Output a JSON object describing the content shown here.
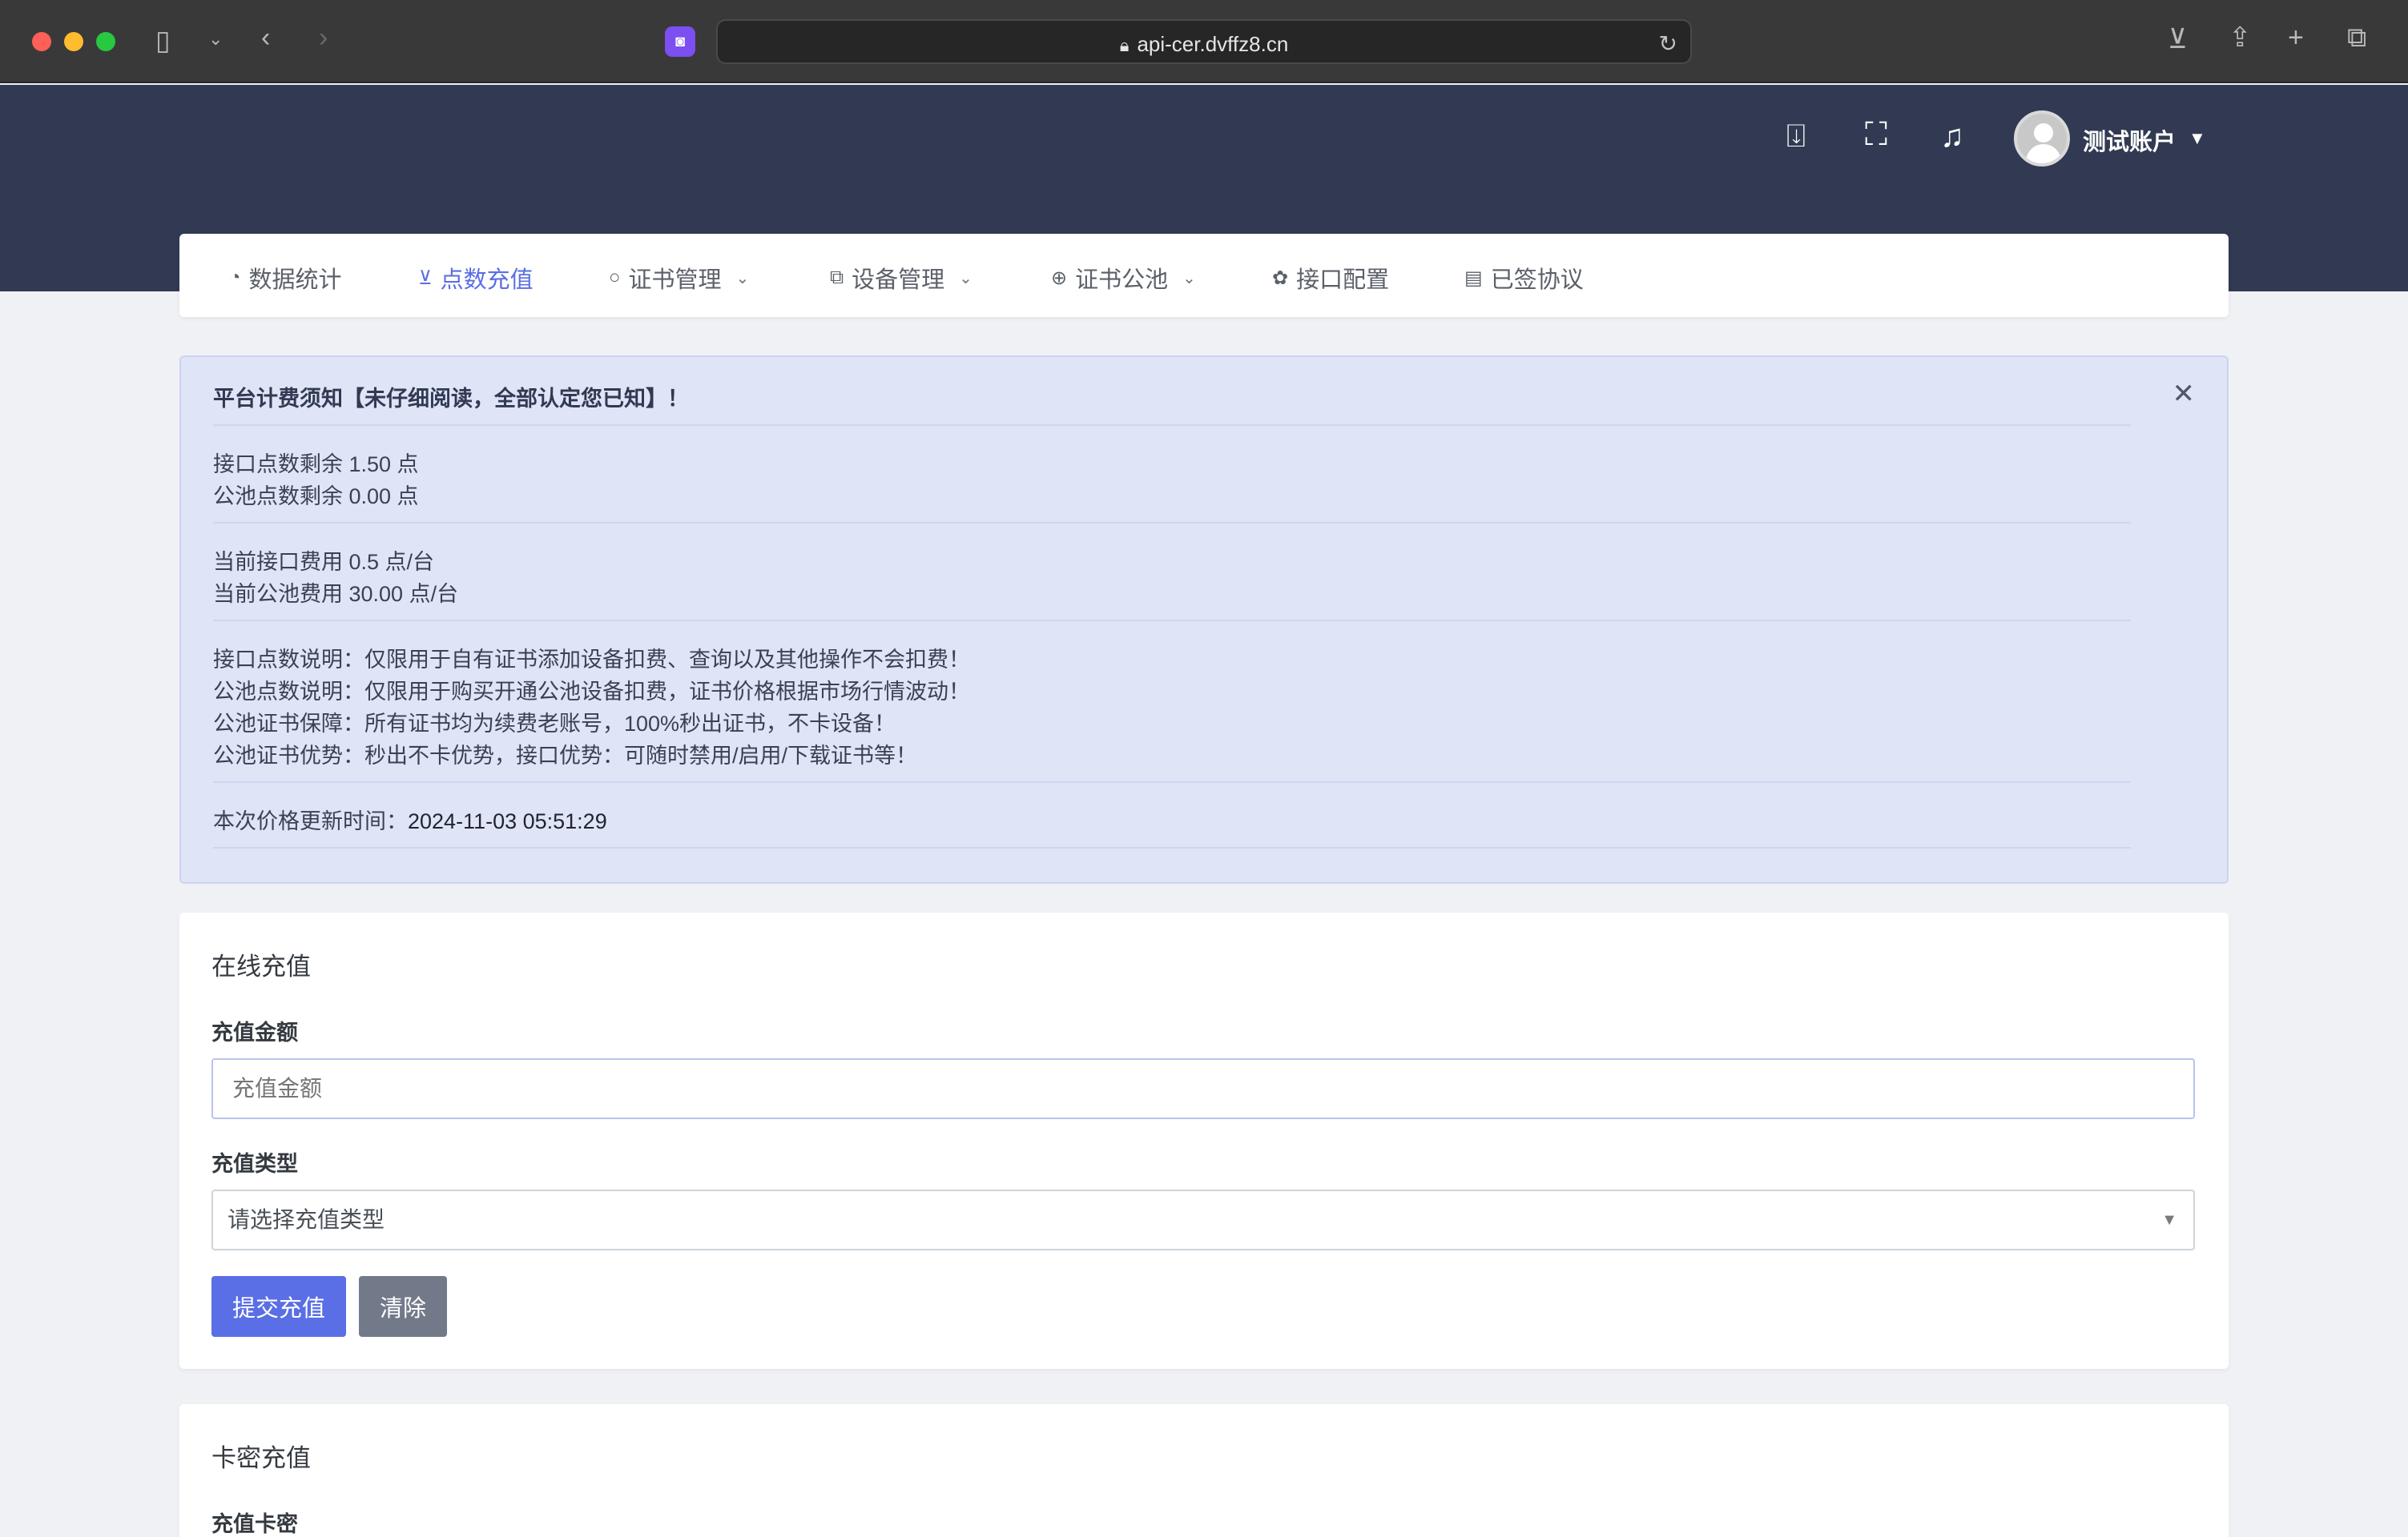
{
  "browser": {
    "url": "api-cer.dvffz8.cn"
  },
  "header": {
    "username": "测试账户"
  },
  "nav": {
    "items": [
      {
        "label": "数据统计",
        "icon": "chart-pie-icon",
        "dropdown": false,
        "active": false
      },
      {
        "label": "点数充值",
        "icon": "cart-icon",
        "dropdown": false,
        "active": true
      },
      {
        "label": "证书管理",
        "icon": "circle-icon",
        "dropdown": true,
        "active": false
      },
      {
        "label": "设备管理",
        "icon": "device-icon",
        "dropdown": true,
        "active": false
      },
      {
        "label": "证书公池",
        "icon": "plus-circle-icon",
        "dropdown": true,
        "active": false
      },
      {
        "label": "接口配置",
        "icon": "puzzle-icon",
        "dropdown": false,
        "active": false
      },
      {
        "label": "已签协议",
        "icon": "document-icon",
        "dropdown": false,
        "active": false
      }
    ]
  },
  "notice": {
    "title": "平台计费须知【未仔细阅读，全部认定您已知】！",
    "api_points": "接口点数剩余 1.50 点",
    "pool_points": "公池点数剩余 0.00 点",
    "api_fee": "当前接口费用 0.5 点/台",
    "pool_fee": "当前公池费用 30.00 点/台",
    "desc1": "接口点数说明：仅限用于自有证书添加设备扣费、查询以及其他操作不会扣费！",
    "desc2": "公池点数说明：仅限用于购买开通公池设备扣费，证书价格根据市场行情波动！",
    "desc3": "公池证书保障：所有证书均为续费老账号，100%秒出证书，不卡设备！",
    "desc4": "公池证书优势：秒出不卡优势，接口优势：可随时禁用/启用/下载证书等！",
    "update_label": "本次价格更新时间：",
    "update_time": "2024-11-03 05:51:29"
  },
  "online_recharge": {
    "title": "在线充值",
    "amount_label": "充值金额",
    "amount_placeholder": "充值金额",
    "type_label": "充值类型",
    "type_selected": "请选择充值类型",
    "submit_label": "提交充值",
    "clear_label": "清除"
  },
  "card_recharge": {
    "title": "卡密充值",
    "card_label": "充值卡密"
  },
  "colors": {
    "header_bg": "#313a52",
    "primary": "#5a6ee5",
    "alert_bg": "#dfe4f7"
  }
}
